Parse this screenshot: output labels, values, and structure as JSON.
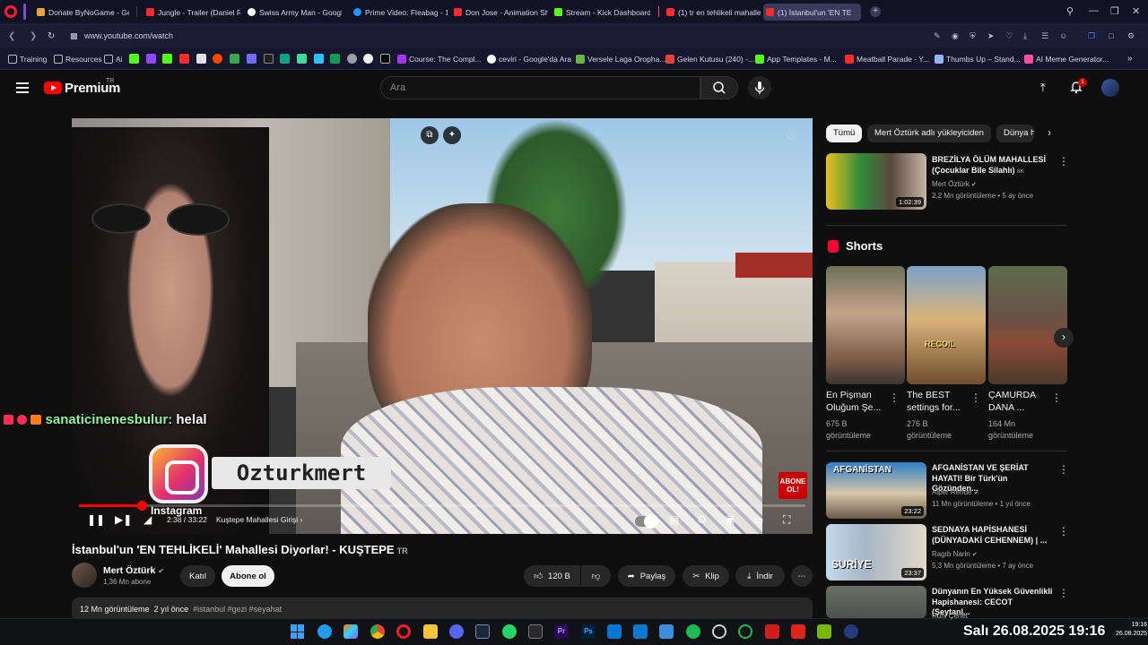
{
  "browser": {
    "tabs": [
      {
        "label": "Donate ByNoGame - Gelen",
        "color": "#e7a33a"
      },
      {
        "label": "Jungle - Trailer (Daniel Ra",
        "color": "#ff2a2a"
      },
      {
        "label": "Swiss Army Man - Google",
        "color": "#ffffff"
      },
      {
        "label": "Prime Video: Fleabag - 1.",
        "color": "#1a98ff"
      },
      {
        "label": "Don Jose - Animation Sho",
        "color": "#ff2a2a"
      },
      {
        "label": "Stream - Kick Dashboard",
        "color": "#53fc18"
      },
      {
        "label": "(1) tr en tehlikeli mahalle",
        "color": "#ff2a2a"
      },
      {
        "label": "(1) İstanbul'un 'EN TE",
        "color": "#ff2a2a"
      }
    ],
    "new_tab": "+",
    "url": "www.youtube.com/watch",
    "bookmarks": [
      {
        "label": "Training",
        "color": "#cfcfe0"
      },
      {
        "label": "Resources",
        "color": "#cfcfe0"
      },
      {
        "label": "Ai",
        "color": "#cfcfe0"
      },
      {
        "label": "Course: The Compl...",
        "color": "#a435f0"
      },
      {
        "label": "ceviri - Google'da Ara",
        "color": "#ffffff"
      },
      {
        "label": "Versele Laga Oropha...",
        "color": "#6db33f"
      },
      {
        "label": "Gelen Kutusu (240) -...",
        "color": "#ea4335"
      },
      {
        "label": "App Templates - M...",
        "color": "#53fc18"
      },
      {
        "label": "Meatball Parade - Y...",
        "color": "#ff2a2a"
      },
      {
        "label": "Thumbs Up – Stand...",
        "color": "#8fb6ff"
      },
      {
        "label": "AI Meme Generator...",
        "color": "#ff4da6"
      }
    ]
  },
  "yt": {
    "brand": "Premium",
    "country": "TR",
    "search_placeholder": "Ara",
    "notif_count": "1"
  },
  "player": {
    "progress": 0.086,
    "time": "2:38 / 33:22",
    "chapter": "Kuştepe Mahallesi Girişi",
    "chat_user": "sanaticinenesbulur:",
    "chat_msg": "helal",
    "ig_handle": "Ozturkmert",
    "ig_label": "Instagram",
    "abone_badge": "ABONE OL!"
  },
  "video": {
    "title": "İstanbul'un 'EN TEHLİKELİ' Mahallesi Diyorlar! - KUŞTEPE",
    "title_badge": "TR",
    "channel": "Mert Öztürk",
    "subscribers": "1,36 Mn abone",
    "join": "Katıl",
    "subscribe": "Abone ol",
    "likes": "120 B",
    "share": "Paylaş",
    "clip": "Klip",
    "download": "İndir",
    "views": "12 Mn görüntüleme",
    "age": "2 yıl önce",
    "tags": "#istanbul #gezi #seyahat"
  },
  "sidebar": {
    "chips": [
      "Tümü",
      "Mert Öztürk adlı yükleyiciden",
      "Dünya h"
    ],
    "shorts_heading": "Shorts",
    "top_video": {
      "title": "BREZİLYA ÖLÜM MAHALLESİ (Çocuklar Bile Silahlı)",
      "badge": "8K",
      "channel": "Mert Öztürk",
      "meta": "2,2 Mn görüntüleme • 5 ay önce",
      "duration": "1:02:39"
    },
    "shorts": [
      {
        "title1": "En Pişman",
        "title2": "Oluğum Şe...",
        "views1": "675 B",
        "views2": "görüntüleme"
      },
      {
        "title1": "The BEST",
        "title2": "settings for...",
        "views1": "276 B",
        "views2": "görüntüleme",
        "overlay": "RECOIL"
      },
      {
        "title1": "ÇAMURDA",
        "title2": "DANA ...",
        "views1": "164 Mn",
        "views2": "görüntüleme"
      }
    ],
    "videos": [
      {
        "title1": "AFGANİSTAN VE ŞERİAT",
        "title2": "HAYATI! Bir Türk'ün Gözünden...",
        "channel": "Alper Rende",
        "meta": "11 Mn görüntüleme • 1 yıl önce",
        "duration": "23:22",
        "thumb_text": "AFGANİSTAN"
      },
      {
        "title1": "SEDNAYA HAPİSHANESİ",
        "title2": "(DÜNYADAKİ CEHENNEM) | ...",
        "channel": "Ragıb Narin",
        "meta": "5,3 Mn görüntüleme • 7 ay önce",
        "duration": "23:37",
        "thumb_text": "SURİYE"
      },
      {
        "title1": "Dünyanın En Yüksek Güvenlikli",
        "title2": "Hapishanesi: CECOT (Şeytanl...",
        "channel": "Ruhi Çenet",
        "meta": "",
        "duration": "",
        "thumb_text": ""
      }
    ]
  },
  "taskbar": {
    "overlay_datetime": "Salı 26.08.2025 19:16",
    "clock_time": "19:16",
    "clock_date": "26.08.2025"
  }
}
